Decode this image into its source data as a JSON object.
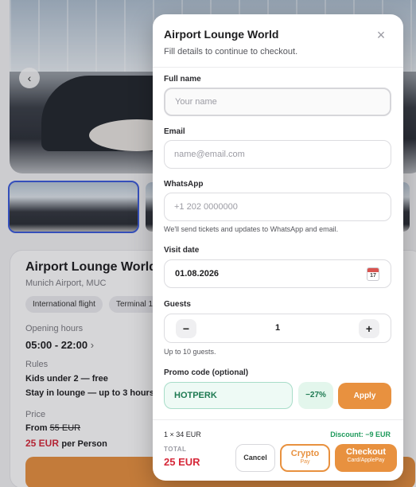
{
  "background": {
    "card": {
      "title": "Airport Lounge World",
      "location": "Munich Airport, MUC",
      "tags": [
        "International flight",
        "Terminal 1"
      ],
      "opening_hours_label": "Opening hours",
      "opening_hours_value": "05:00 - 22:00",
      "rules_label": "Rules",
      "rules": [
        "Kids under 2 — free",
        "Stay in lounge — up to 3 hours"
      ],
      "price_label": "Price",
      "price_from_prefix": "From",
      "price_old": "55 EUR",
      "price_now": "25 EUR",
      "price_unit": "per Person"
    }
  },
  "modal": {
    "title": "Airport Lounge World",
    "subtitle": "Fill details to continue to checkout.",
    "full_name": {
      "label": "Full name",
      "placeholder": "Your name",
      "value": ""
    },
    "email": {
      "label": "Email",
      "placeholder": "name@email.com",
      "value": ""
    },
    "whatsapp": {
      "label": "WhatsApp",
      "placeholder": "+1 202 0000000",
      "value": "",
      "hint": "We'll send tickets and updates to WhatsApp and email."
    },
    "visit_date": {
      "label": "Visit date",
      "value": "01.08.2026",
      "calendar_day": "17"
    },
    "guests": {
      "label": "Guests",
      "minus": "−",
      "value": "1",
      "plus": "+",
      "hint": "Up to 10 guests."
    },
    "promo": {
      "label": "Promo code (optional)",
      "value": "HOTPERK",
      "badge": "−27%",
      "apply": "Apply"
    },
    "footer": {
      "calc": "1 × 34 EUR",
      "discount": "Discount: −9 EUR",
      "total_label": "TOTAL",
      "total_value": "25 EUR",
      "cancel": "Cancel",
      "crypto": "Crypto",
      "crypto_sub": "Pay",
      "checkout": "Checkout",
      "checkout_sub": "Card/ApplePay"
    }
  },
  "colors": {
    "accent": "#e8913f",
    "price_red": "#d62839",
    "promo_green": "#1e7a52"
  }
}
